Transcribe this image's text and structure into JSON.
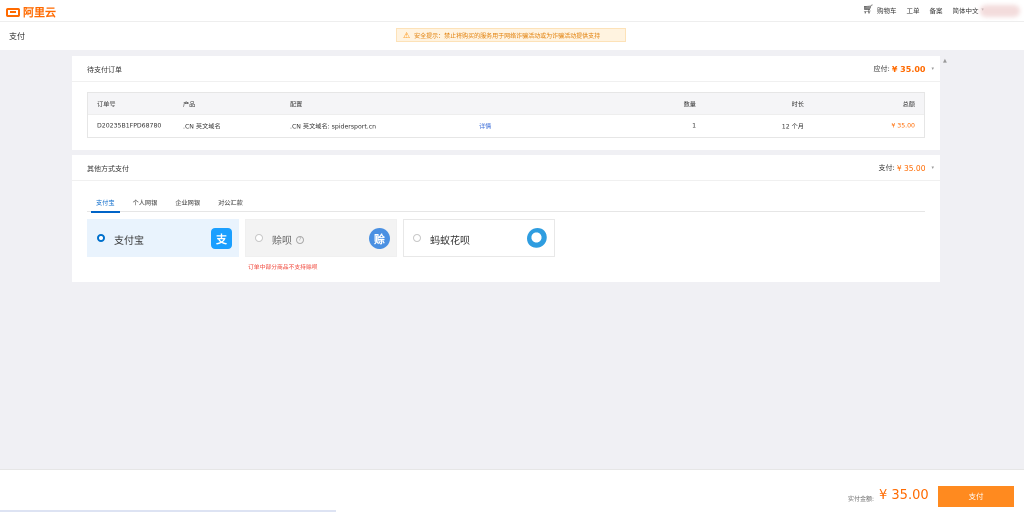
{
  "topnav": {
    "logo_text": "阿里云",
    "cart": "购物车",
    "ticket": "工单",
    "filing": "备案",
    "language": "简体中文",
    "chevron": "▾"
  },
  "page": {
    "title": "支付",
    "warning": "安全提示：禁止将购买的服务用于网络诈骗活动或为诈骗活动提供支持"
  },
  "pending_order": {
    "title": "待支付订单",
    "amount_label": "应付:",
    "amount": "¥ 35.00",
    "columns": {
      "order_no": "订单号",
      "product": "产品",
      "config": "配置",
      "qty": "数量",
      "duration": "时长",
      "total": "总额"
    },
    "rows": [
      {
        "order_no": "D20235B1FPD68780",
        "product": ".CN 英文域名",
        "config": ".CN 英文域名: spidersport.cn",
        "detail": "详情",
        "qty": "1",
        "duration": "12 个月",
        "total": "¥ 35.00"
      }
    ]
  },
  "other_payment": {
    "title": "其他方式支付",
    "amount_label": "支付:",
    "amount": "¥ 35.00",
    "tabs": [
      "支付宝",
      "个人网银",
      "企业网银",
      "对公汇款"
    ],
    "options": [
      {
        "label": "支付宝",
        "icon_text": "支"
      },
      {
        "label": "赊呗",
        "icon_text": "赊",
        "help": "?"
      },
      {
        "label": "蚂蚁花呗",
        "icon_text": ""
      }
    ],
    "error": "订单中部分商品不支持赊呗"
  },
  "footer": {
    "amount_label": "实付金额:",
    "amount": "¥ 35.00",
    "pay_button": "支付"
  },
  "colors": {
    "brand_orange": "#ff6a00",
    "accent_blue": "#0064c8",
    "error_red": "#f04134"
  },
  "icons": [
    "logo-icon",
    "cart-icon",
    "warning-icon",
    "alipay-icon",
    "zanbei-icon",
    "huabei-icon",
    "help-icon",
    "chevron-down-icon"
  ]
}
